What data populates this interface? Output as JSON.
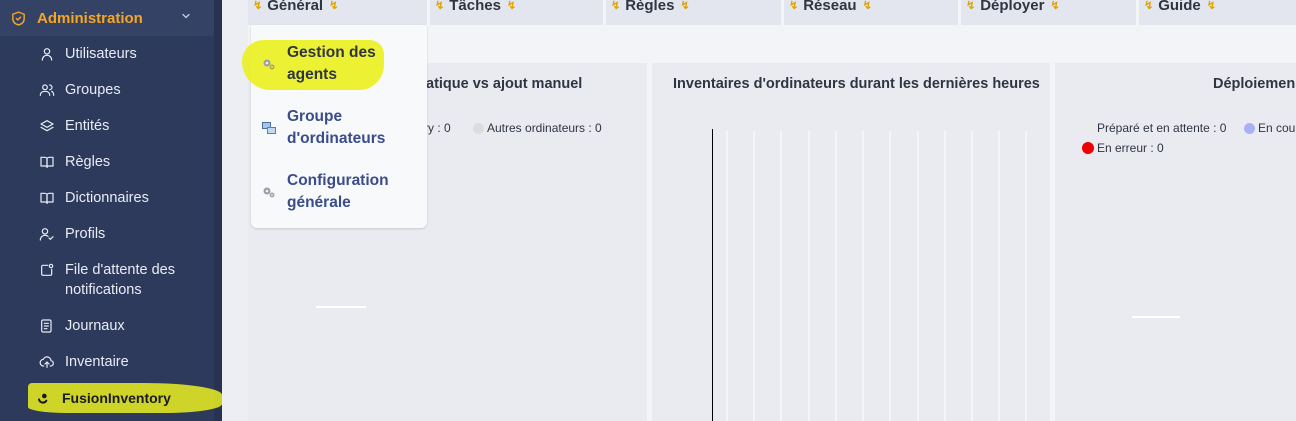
{
  "sidebar": {
    "section_title": "Administration",
    "items": [
      {
        "label": "Utilisateurs",
        "icon": "user-icon"
      },
      {
        "label": "Groupes",
        "icon": "users-icon"
      },
      {
        "label": "Entités",
        "icon": "layers-icon"
      },
      {
        "label": "Règles",
        "icon": "book-icon"
      },
      {
        "label": "Dictionnaires",
        "icon": "book-icon"
      },
      {
        "label": "Profils",
        "icon": "user-check-icon"
      },
      {
        "label": "File d'attente des notifications",
        "icon": "notification-icon"
      },
      {
        "label": "Journaux",
        "icon": "log-icon"
      },
      {
        "label": "Inventaire",
        "icon": "cloud-upload-icon"
      },
      {
        "label": "FusionInventory",
        "icon": "fusion-icon"
      }
    ]
  },
  "topnav": {
    "tabs": [
      {
        "label": "Général"
      },
      {
        "label": "Tâches"
      },
      {
        "label": "Règles"
      },
      {
        "label": "Réseau"
      },
      {
        "label": "Déployer"
      },
      {
        "label": "Guide"
      }
    ]
  },
  "dropdown": {
    "items": [
      {
        "label": "Gestion des agents",
        "icon": "gears-icon"
      },
      {
        "label": "Groupe d'ordinateurs",
        "icon": "computer-group-icon"
      },
      {
        "label": "Configuration générale",
        "icon": "gears-icon"
      }
    ]
  },
  "panels": {
    "panel1": {
      "title_visible": "atique vs ajout manuel",
      "legend_partial": "ry : 0",
      "legend_other": "Autres ordinateurs : 0"
    },
    "panel2": {
      "title": "Inventaires d'ordinateurs durant les dernières heures"
    },
    "panel3": {
      "title_visible": "Déploiemen",
      "legend": [
        {
          "label": "Préparé et en attente : 0",
          "color": "#ebebeb"
        },
        {
          "label": "En cou",
          "color": "#aab0f5"
        },
        {
          "label": "En erreur : 0",
          "color": "#ee0000"
        }
      ]
    }
  },
  "colors": {
    "sidebar_bg": "#2e3a5c",
    "accent": "#f5a623",
    "highlight": "#eaf01e",
    "link": "#3a4c8a"
  }
}
